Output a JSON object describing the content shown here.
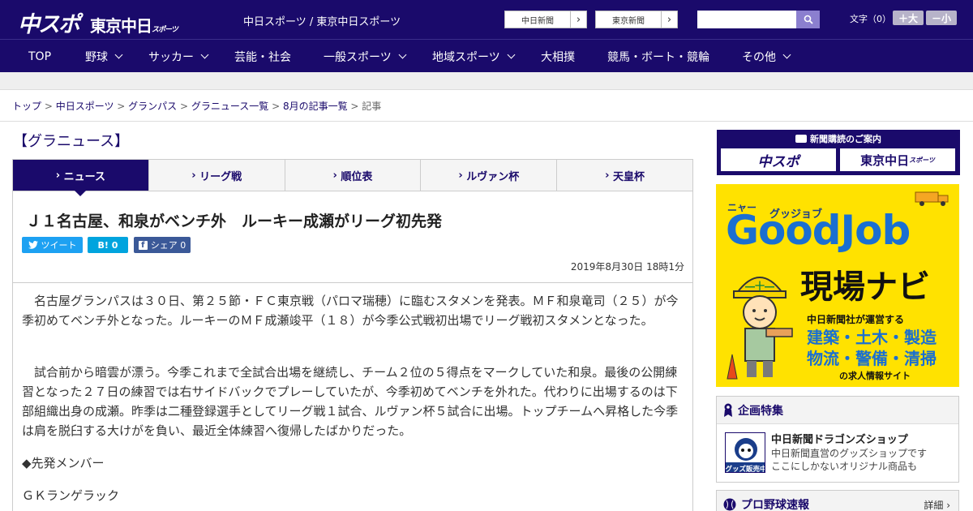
{
  "header": {
    "logo_main": "中スポ",
    "logo_tokyo": "東京中日",
    "logo_tokyo_small": "スポーツ",
    "site_name": "中日スポーツ / 東京中日スポーツ",
    "links": [
      "中日新聞",
      "東京新聞"
    ],
    "font_size_label": "文字（0）",
    "font_plus": "＋大",
    "font_minus": "－小"
  },
  "nav": {
    "items": [
      {
        "label": "TOP",
        "has_menu": false
      },
      {
        "label": "野球",
        "has_menu": true
      },
      {
        "label": "サッカー",
        "has_menu": true
      },
      {
        "label": "芸能・社会",
        "has_menu": false
      },
      {
        "label": "一般スポーツ",
        "has_menu": true
      },
      {
        "label": "地域スポーツ",
        "has_menu": true
      },
      {
        "label": "大相撲",
        "has_menu": false
      },
      {
        "label": "競馬・ボート・競輪",
        "has_menu": false
      },
      {
        "label": "その他",
        "has_menu": true
      }
    ]
  },
  "breadcrumb": {
    "items": [
      "トップ",
      "中日スポーツ",
      "グランパス",
      "グラニュース一覧",
      "8月の記事一覧"
    ],
    "current": "記事",
    "separator": " > "
  },
  "section_title": "【グラニュース】",
  "tabs": [
    {
      "label": "ニュース",
      "active": true
    },
    {
      "label": "リーグ戦",
      "active": false
    },
    {
      "label": "順位表",
      "active": false
    },
    {
      "label": "ルヴァン杯",
      "active": false
    },
    {
      "label": "天皇杯",
      "active": false
    }
  ],
  "article": {
    "headline": "Ｊ１名古屋、和泉がベンチ外　ルーキー成瀬がリーグ初先発",
    "share": {
      "tweet": "ツイート",
      "hatena": "B! 0",
      "facebook": "シェア 0"
    },
    "date": "2019年8月30日 18時1分",
    "paragraphs": [
      "　名古屋グランパスは３０日、第２５節・ＦＣ東京戦（パロマ瑞穂）に臨むスタメンを発表。ＭＦ和泉竜司（２５）が今季初めてベンチ外となった。ルーキーのＭＦ成瀬竣平（１８）が今季公式戦初出場でリーグ戦初スタメンとなった。",
      "　試合前から暗雲が漂う。今季これまで全試合出場を継続し、チーム２位の５得点をマークしていた和泉。最後の公開練習となった２７日の練習では右サイドバックでプレーしていたが、今季初めてベンチを外れた。代わりに出場するのは下部組織出身の成瀬。昨季は二種登録選手としてリーグ戦１試合、ルヴァン杯５試合に出場。トップチームへ昇格した今季は肩を脱臼する大けがを負い、最近全体練習へ復帰したばかりだった。",
      "◆先発メンバー",
      "ＧＫランゲラック"
    ]
  },
  "sidebar": {
    "subscription": {
      "heading": "新聞購読のご案内",
      "logos": [
        "中スポ",
        "東京中日"
      ],
      "logo_small": "スポーツ"
    },
    "ad": {
      "nyu": "ニャー",
      "kana": "グッジョブ",
      "brand": "GoodJob",
      "title": "現場ナビ",
      "sub": "中日新聞社が運営する",
      "lines": [
        "建築・土木・製造",
        "物流・警備・清掃"
      ],
      "foot": "の求人情報サイト"
    },
    "feature": {
      "heading": "企画特集",
      "shop_title": "中日新聞ドラゴンズショップ",
      "shop_desc": [
        "中日新聞直営のグッズショップです",
        "ここにしかないオリジナル商品も"
      ],
      "shop_badge": "グッズ販売中"
    },
    "baseball": {
      "heading": "プロ野球速報",
      "detail": "詳細 ›"
    }
  },
  "colors": {
    "brand": "#1a0a6b",
    "accent_blue": "#1a6fd1",
    "ad_yellow": "#ffe200",
    "twitter": "#1da1f2",
    "hatena": "#00a4de",
    "facebook": "#3b5998"
  }
}
